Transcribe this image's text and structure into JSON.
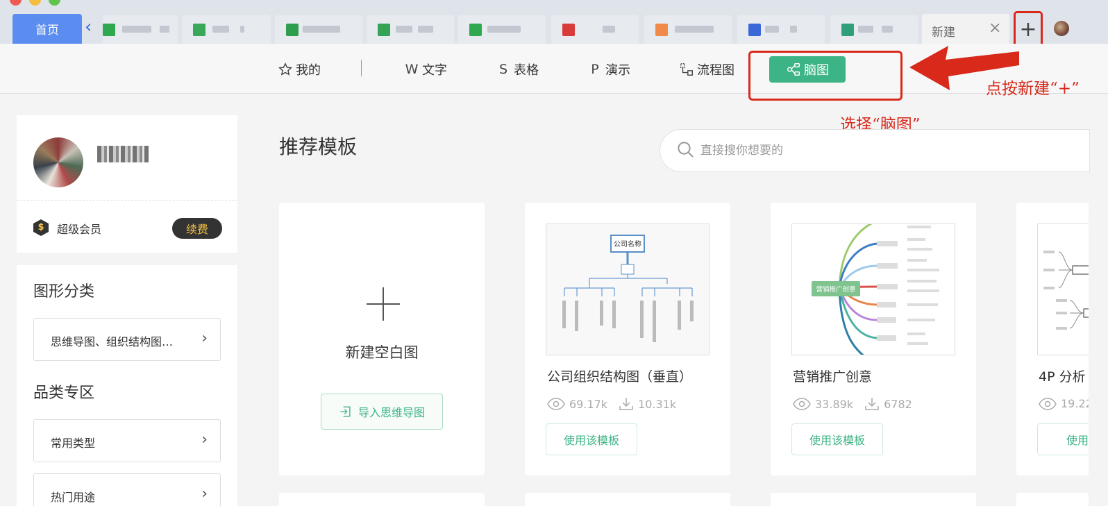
{
  "tabbar": {
    "home_label": "首页",
    "new_tab_label": "新建",
    "new_tab_close": "×",
    "plus": "+"
  },
  "toolbar": {
    "mine": "我的",
    "text": "文字",
    "sheet": "表格",
    "present": "演示",
    "flow": "流程图",
    "mind": "脑图"
  },
  "annotations": {
    "click_new": "点按新建“+”",
    "choose_mind": "选择“脑图”"
  },
  "profile": {
    "vip_label": "超级会员",
    "renew_label": "续费"
  },
  "sidebar": {
    "graphic_category_title": "图形分类",
    "graphic_category_value": "思维导图、组织结构图…",
    "zone_title": "品类专区",
    "zone_items": [
      {
        "label": "常用类型"
      },
      {
        "label": "热门用途"
      }
    ]
  },
  "main": {
    "title": "推荐模板",
    "search_placeholder": "直接搜你想要的",
    "blank": {
      "title": "新建空白图",
      "import_label": "导入思维导图"
    },
    "templates": [
      {
        "name": "公司组织结构图（垂直）",
        "views": "69.17k",
        "downloads": "10.31k",
        "use_label": "使用该模板"
      },
      {
        "name": "营销推广创意",
        "views": "33.89k",
        "downloads": "6782",
        "use_label": "使用该模板"
      },
      {
        "name": "4P 分析",
        "views": "19.22",
        "use_label": "使用该"
      }
    ]
  },
  "thumbnails": {
    "org_root": "公司名称",
    "mind_center": "营销推广创意"
  },
  "colors": {
    "accent_green": "#3cb486",
    "home_tab_blue": "#5b8cf0",
    "annotation_red": "#d8291b"
  }
}
